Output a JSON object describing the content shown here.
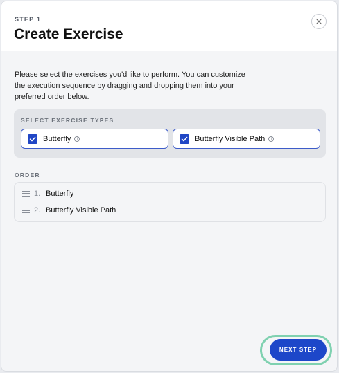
{
  "header": {
    "step_label": "STEP 1",
    "title": "Create Exercise",
    "close_icon": "close-icon"
  },
  "description": "Please select the exercises you'd like to perform. You can customize the execution sequence by dragging and dropping them into your preferred order below.",
  "exercise_types": {
    "label": "SELECT EXERCISE TYPES",
    "items": [
      {
        "name": "Butterfly",
        "checked": true,
        "icon": "info-icon"
      },
      {
        "name": "Butterfly Visible Path",
        "checked": true,
        "icon": "info-icon"
      }
    ]
  },
  "order": {
    "label": "ORDER",
    "items": [
      {
        "number": "1.",
        "name": "Butterfly",
        "icon": "drag-handle-icon"
      },
      {
        "number": "2.",
        "name": "Butterfly Visible Path",
        "icon": "drag-handle-icon"
      }
    ]
  },
  "footer": {
    "next_label": "NEXT STEP"
  },
  "colors": {
    "accent": "#1d47c9",
    "focus_ring": "#7fd1b0",
    "checkbox": "#2147c5"
  }
}
